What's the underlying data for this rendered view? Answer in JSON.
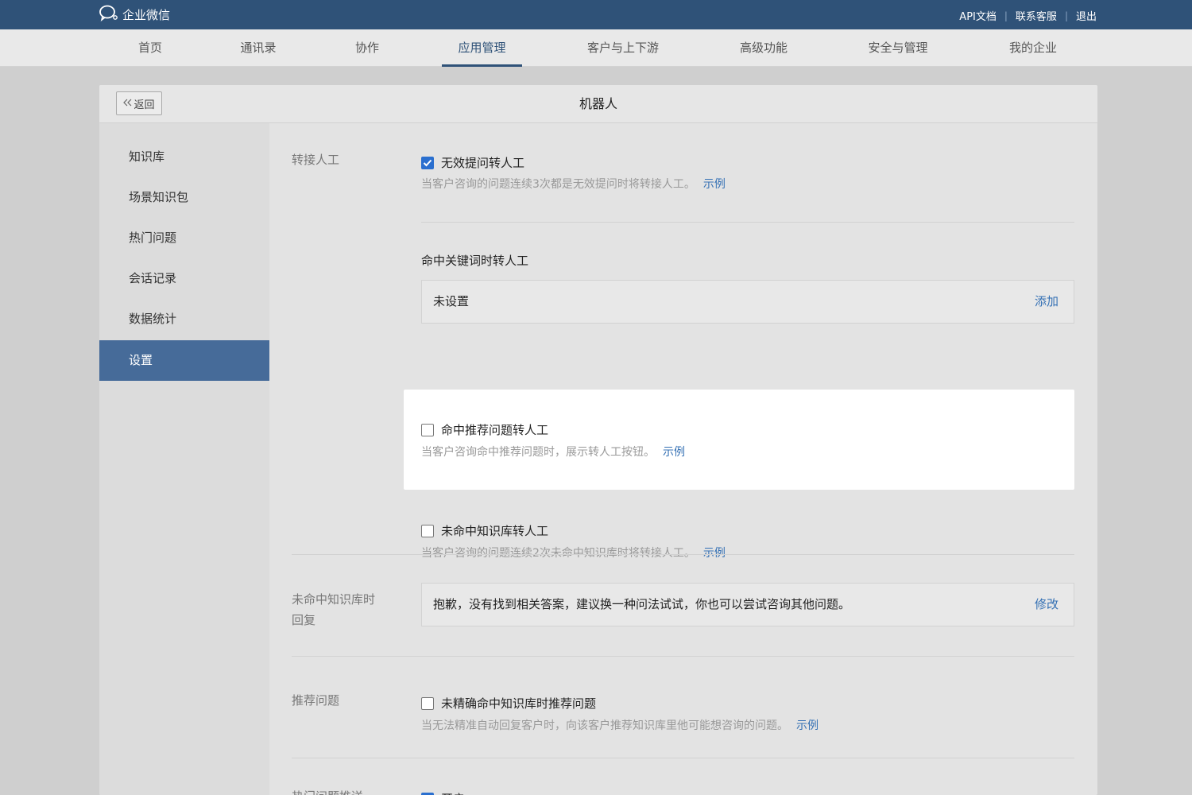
{
  "header": {
    "brand": "企业微信",
    "links": [
      "API文档",
      "联系客服",
      "退出"
    ]
  },
  "nav": {
    "items": [
      "首页",
      "通讯录",
      "协作",
      "应用管理",
      "客户与上下游",
      "高级功能",
      "安全与管理",
      "我的企业"
    ],
    "active": "应用管理"
  },
  "panel": {
    "back_label": "返回",
    "title": "机器人"
  },
  "sidebar": {
    "items": [
      "知识库",
      "场景知识包",
      "热门问题",
      "会话记录",
      "数据统计",
      "设置"
    ],
    "active": "设置"
  },
  "settings": {
    "transfer": {
      "label": "转接人工",
      "invalid_q": {
        "label": "无效提问转人工",
        "checked": true,
        "desc": "当客户咨询的问题连续3次都是无效提问时将转接人工。",
        "example": "示例"
      },
      "keyword": {
        "title": "命中关键词时转人工",
        "value": "未设置",
        "action": "添加"
      },
      "recommended": {
        "label": "命中推荐问题转人工",
        "checked": false,
        "desc": "当客户咨询命中推荐问题时，展示转人工按钮。",
        "example": "示例"
      },
      "miss_kb": {
        "label": "未命中知识库转人工",
        "checked": false,
        "desc": "当客户咨询的问题连续2次未命中知识库时将转接人工。",
        "example": "示例"
      }
    },
    "miss_reply": {
      "label_line1": "未命中知识库时",
      "label_line2": "回复",
      "value": "抱歉，没有找到相关答案，建议换一种问法试试，你也可以尝试咨询其他问题。",
      "action": "修改"
    },
    "recommend": {
      "label": "推荐问题",
      "option": {
        "label": "未精确命中知识库时推荐问题",
        "checked": false,
        "desc": "当无法精准自动回复客户时，向该客户推荐知识库里他可能想咨询的问题。",
        "example": "示例"
      }
    },
    "hot": {
      "label": "热门问题推送",
      "option_label": "开启",
      "checked": true
    }
  },
  "colors": {
    "header_bg": "#2f5278",
    "accent_blue": "#3470b4",
    "sidebar_active": "#466b99",
    "checkbox_checked": "#2a6fcf"
  }
}
